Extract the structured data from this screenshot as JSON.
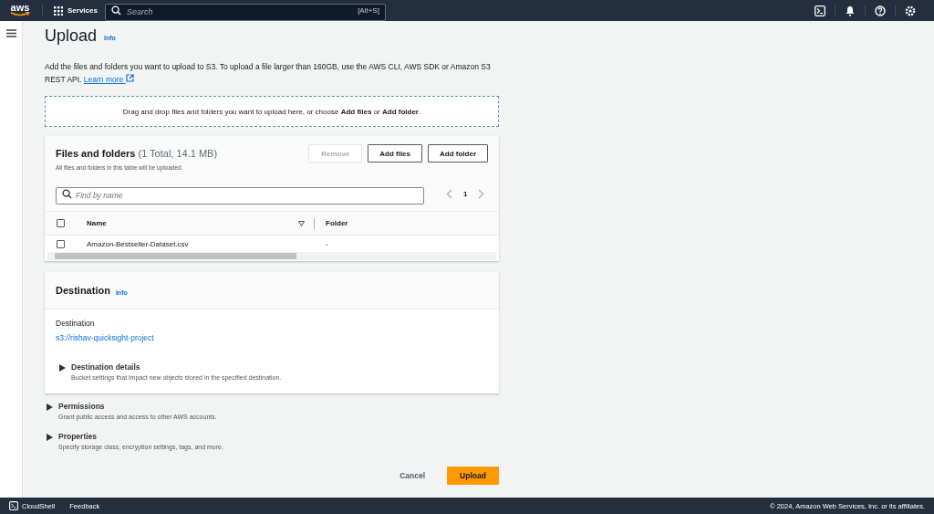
{
  "top_nav": {
    "logo": "aws",
    "services": "Services",
    "search": {
      "placeholder": "Search",
      "shortcut": "[Alt+S]"
    }
  },
  "page": {
    "title": "Upload",
    "info": "Info",
    "description": "Add the files and folders you want to upload to S3. To upload a file larger than 160GB, use the AWS CLI, AWS SDK or Amazon S3 REST API.",
    "learn_more": "Learn more"
  },
  "drop_zone": "Drag and drop files and folders you want to upload here, or choose **Add files** or **Add folder**.",
  "files_panel": {
    "title": "Files and folders",
    "count": "(1 Total, 14.1 MB)",
    "subtitle": "All files and folders in this table will be uploaded.",
    "buttons": [
      {
        "label": "Remove",
        "disabled": true
      },
      {
        "label": "Add files",
        "disabled": false
      },
      {
        "label": "Add folder",
        "disabled": false
      }
    ],
    "search": {
      "placeholder": "Find by name"
    },
    "page": "1",
    "header_checked": false,
    "columns": [
      "Name",
      "Folder"
    ],
    "rows": [
      {
        "checked": false,
        "name": "Amazon-Bestseller-Dataset.csv",
        "folder": "-"
      }
    ]
  },
  "destination": {
    "title": "Destination",
    "info": "Info",
    "label": "Destination",
    "value": "s3://rishav-quicksight-project",
    "details": {
      "title": "Destination details",
      "description": "Bucket settings that impact new objects stored in the specified destination.",
      "expanded": false
    }
  },
  "sections": [
    {
      "title": "Permissions",
      "description": "Grant public access and access to other AWS accounts.",
      "expanded": false
    },
    {
      "title": "Properties",
      "description": "Specify storage class, encryption settings, tags, and more.",
      "expanded": false
    }
  ],
  "actions": {
    "cancel": "Cancel",
    "upload": "Upload"
  },
  "footer": {
    "cloudshell": "CloudShell",
    "feedback": "Feedback",
    "copyright": "© 2024, Amazon Web Services, Inc. or its affiliates."
  }
}
